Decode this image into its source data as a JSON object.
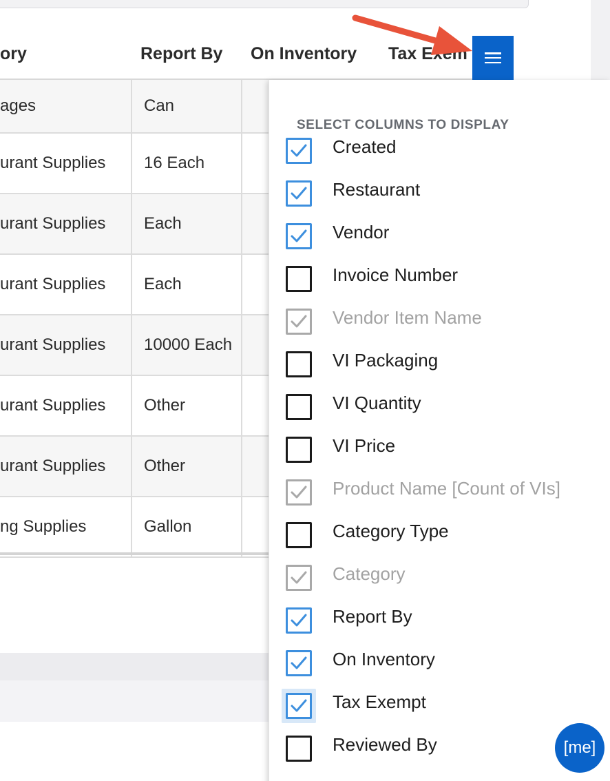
{
  "table": {
    "headers": {
      "category": "ory",
      "report_by": "Report By",
      "on_inventory": "On Inventory",
      "tax_exempt": "Tax Exem"
    },
    "rows": [
      {
        "category": "ages",
        "report_by": "Can"
      },
      {
        "category": "urant Supplies",
        "report_by": "16 Each"
      },
      {
        "category": "urant Supplies",
        "report_by": "Each"
      },
      {
        "category": "urant Supplies",
        "report_by": "Each"
      },
      {
        "category": "urant Supplies",
        "report_by": "10000 Each"
      },
      {
        "category": "urant Supplies",
        "report_by": "Other"
      },
      {
        "category": "urant Supplies",
        "report_by": "Other"
      },
      {
        "category": "ng Supplies",
        "report_by": "Gallon"
      }
    ]
  },
  "column_menu": {
    "button_icon": "hamburger-menu-icon",
    "title": "SELECT COLUMNS TO DISPLAY",
    "options": [
      {
        "label": "Created",
        "checked": true,
        "disabled": false
      },
      {
        "label": "Restaurant",
        "checked": true,
        "disabled": false
      },
      {
        "label": "Vendor",
        "checked": true,
        "disabled": false
      },
      {
        "label": "Invoice Number",
        "checked": false,
        "disabled": false
      },
      {
        "label": "Vendor Item Name",
        "checked": true,
        "disabled": true
      },
      {
        "label": "VI Packaging",
        "checked": false,
        "disabled": false
      },
      {
        "label": "VI Quantity",
        "checked": false,
        "disabled": false
      },
      {
        "label": "VI Price",
        "checked": false,
        "disabled": false
      },
      {
        "label": "Product Name [Count of VIs]",
        "checked": true,
        "disabled": true
      },
      {
        "label": "Category Type",
        "checked": false,
        "disabled": false
      },
      {
        "label": "Category",
        "checked": true,
        "disabled": true
      },
      {
        "label": "Report By",
        "checked": true,
        "disabled": false
      },
      {
        "label": "On Inventory",
        "checked": true,
        "disabled": false
      },
      {
        "label": "Tax Exempt",
        "checked": true,
        "disabled": false,
        "focused": true
      },
      {
        "label": "Reviewed By",
        "checked": false,
        "disabled": false
      }
    ]
  },
  "chat_badge": {
    "label": "[me]"
  },
  "colors": {
    "primary": "#0a63c9",
    "check_active": "#3d8fde",
    "check_disabled": "#a9a9a9",
    "annotation_arrow": "#e8533a"
  }
}
